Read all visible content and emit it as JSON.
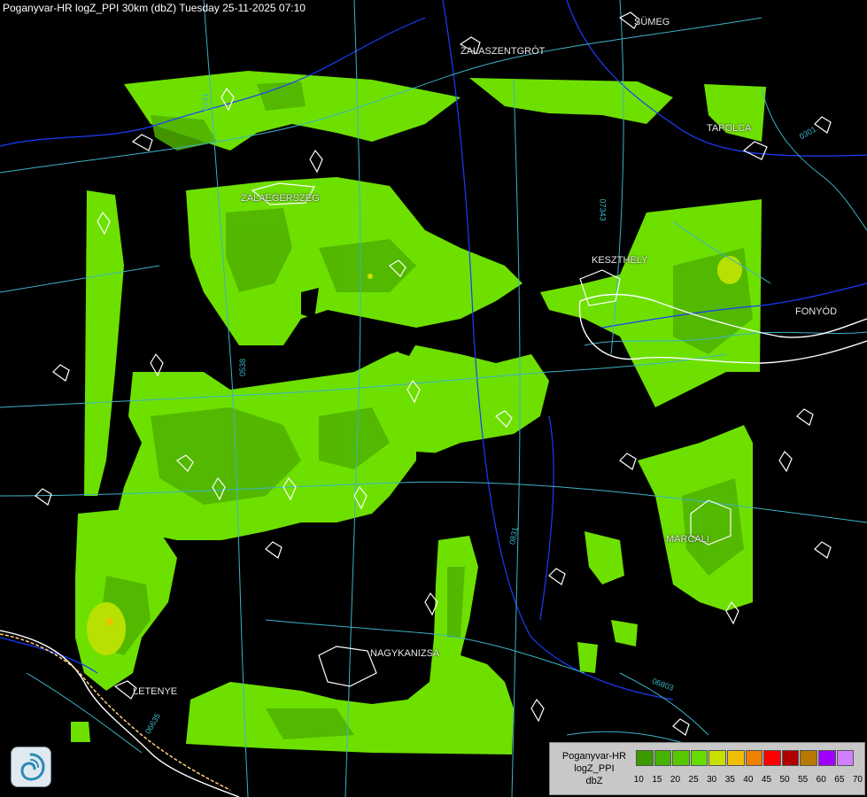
{
  "header": {
    "title": "Poganyvar-HR logZ_PPI 30km (dbZ) Tuesday 25-11-2025 07:10"
  },
  "towns": {
    "sumeg": "SÜMEG",
    "zalaszentgrot": "ZALASZENTGRÓT",
    "tapolca": "TAPOLCA",
    "zalaegerszeg": "ZALAEGERSZEG",
    "keszthely": "KESZTHELY",
    "fonyod": "FONYÓD",
    "marcali": "MARCALI",
    "nagykanizsa": "NAGYKANIZSA",
    "letenye": "LETENYE"
  },
  "roads": {
    "r0741": "0741",
    "r07343": "07343",
    "r0538": "0538",
    "r0831": "0831",
    "r06803": "06803",
    "r06635": "06635",
    "r0301": "0301"
  },
  "legend": {
    "station": "Poganyvar-HR",
    "product": "logZ_PPI",
    "unit": "dbZ",
    "ticks": [
      "10",
      "15",
      "20",
      "25",
      "30",
      "35",
      "40",
      "45",
      "50",
      "55",
      "60",
      "65",
      "70"
    ],
    "colors": [
      "#3a9a00",
      "#47b300",
      "#57c800",
      "#66dd00",
      "#c8e000",
      "#f0c000",
      "#f08000",
      "#ff0000",
      "#b00000",
      "#b87800",
      "#a000ff",
      "#d080ff",
      "#a0a0ff"
    ]
  },
  "colors": {
    "background": "#000000",
    "radar_light": "#6ee000",
    "radar_mid": "#5fcc00",
    "radar_dark": "#4fb000",
    "radar_peak": "#b8e000",
    "boundary": "#ffffff",
    "rivers": "#1a3cff",
    "roads": "#3bb3c6"
  }
}
